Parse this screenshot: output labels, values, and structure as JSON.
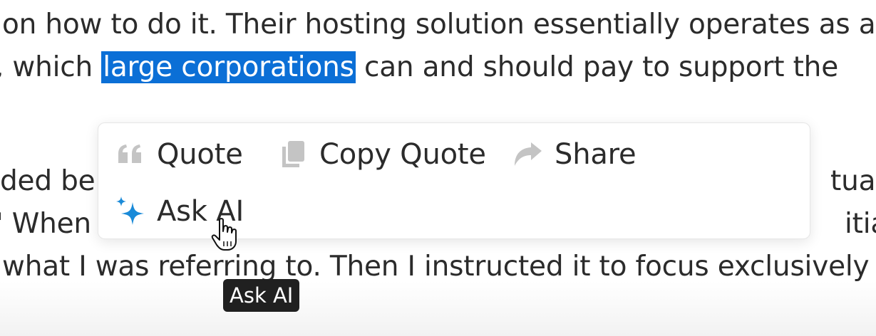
{
  "article": {
    "line1": "on how to do it. Their hosting solution essentially operates as a",
    "line2_before": ", which ",
    "line2_highlight": "large corporations",
    "line2_after": " can and should pay to support the",
    "line4_left": "ded bel",
    "line4_right": "tually",
    "line5_left": "' When I",
    "line5_right": "itially",
    "line6": "what I was referring to. Then I instructed it to focus exclusively on"
  },
  "popup_menu": {
    "quote_label": "Quote",
    "copy_quote_label": "Copy Quote",
    "share_label": "Share",
    "ask_ai_label": "Ask AI"
  },
  "tooltip": {
    "text": "Ask AI"
  },
  "icons": {
    "quote": "quote-icon",
    "copy": "copy-icon",
    "share": "share-icon",
    "ask_ai": "sparkle-icon",
    "cursor": "hand-pointer-cursor"
  },
  "colors": {
    "selection": "#0b6fd6",
    "text": "#2b2b2b",
    "icon_gray": "#c4c4c4",
    "ai_blue": "#1a8ad8",
    "tooltip_bg": "#202020"
  }
}
